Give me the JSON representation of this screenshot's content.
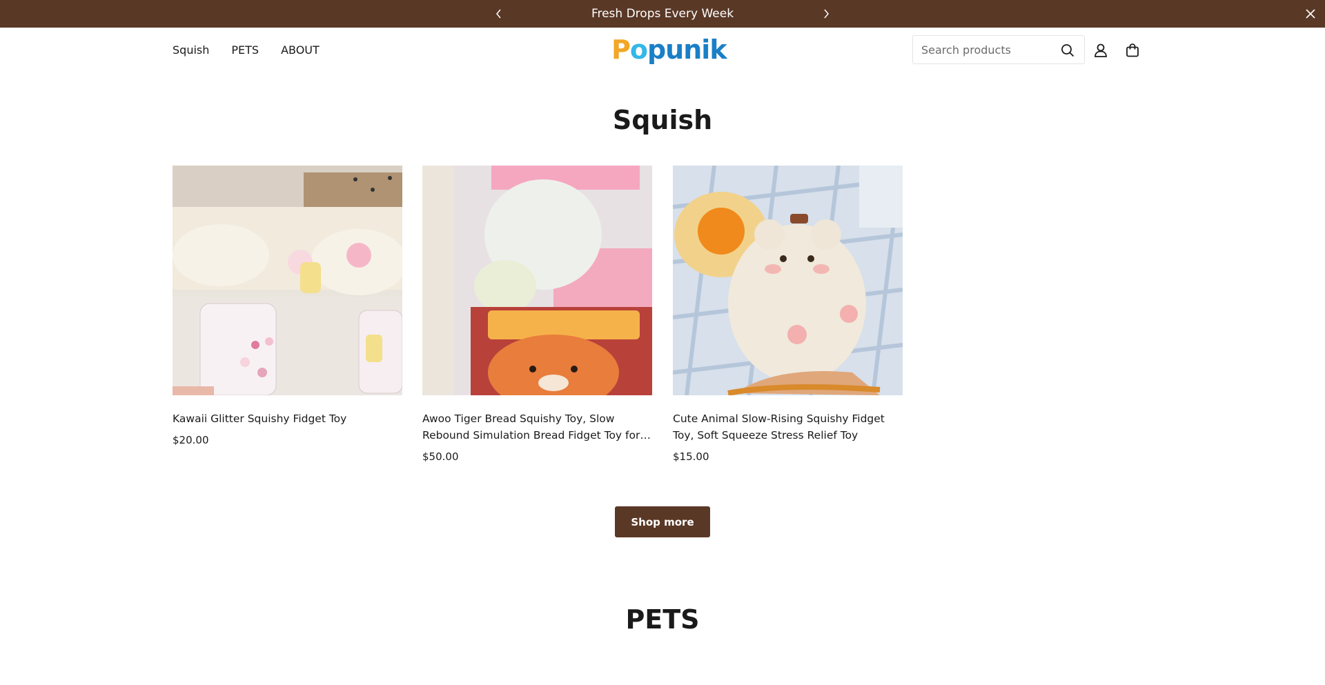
{
  "announcement": {
    "text": "Fresh Drops Every Week",
    "prev_icon": "chevron-left-icon",
    "next_icon": "chevron-right-icon",
    "close_icon": "close-icon"
  },
  "nav": {
    "items": [
      {
        "label": "Squish"
      },
      {
        "label": "PETS"
      },
      {
        "label": "ABOUT"
      }
    ]
  },
  "logo": {
    "text": "Popunik",
    "letters": [
      {
        "ch": "P",
        "color": "#f2a726"
      },
      {
        "ch": "o",
        "color": "#35b7e8"
      },
      {
        "ch": "p",
        "color": "#1a7fc6"
      },
      {
        "ch": "u",
        "color": "#1a7fc6"
      },
      {
        "ch": "n",
        "color": "#1a7fc6"
      },
      {
        "ch": "i",
        "color": "#1a7fc6"
      },
      {
        "ch": "k",
        "color": "#1a7fc6"
      }
    ]
  },
  "search": {
    "placeholder": "Search products",
    "value": "",
    "icon": "search-icon"
  },
  "header_icons": {
    "account": "user-icon",
    "cart": "shopping-bag-icon"
  },
  "sections": {
    "squish": {
      "title": "Squish",
      "products": [
        {
          "name": "Kawaii Glitter Squishy Fidget Toy",
          "price": "$20.00"
        },
        {
          "name": "Awoo Tiger Bread Squishy Toy, Slow Rebound Simulation Bread Fidget Toy for Collection & Stress Relief",
          "price": "$50.00"
        },
        {
          "name": "Cute Animal Slow-Rising Squishy Fidget Toy, Soft Squeeze Stress Relief Toy",
          "price": "$15.00"
        }
      ],
      "shop_more_label": "Shop more"
    },
    "pets": {
      "title": "PETS"
    }
  },
  "colors": {
    "brand_brown": "#5a3826",
    "text": "#1a1a1a"
  }
}
